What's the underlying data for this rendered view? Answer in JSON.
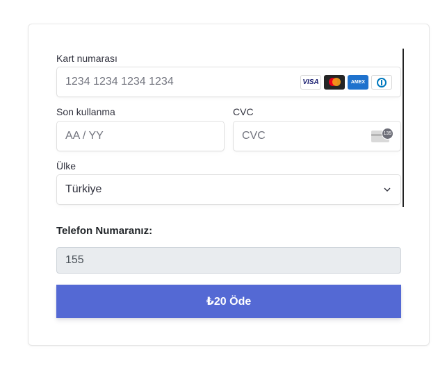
{
  "payment_form": {
    "card_number": {
      "label": "Kart numarası",
      "placeholder": "1234 1234 1234 1234"
    },
    "card_brands": [
      {
        "name": "visa-icon",
        "text": "VISA"
      },
      {
        "name": "mastercard-icon",
        "text": ""
      },
      {
        "name": "amex-icon",
        "text": "AMEX"
      },
      {
        "name": "diners-icon",
        "text": ""
      }
    ],
    "expiry": {
      "label": "Son kullanma",
      "placeholder": "AA / YY"
    },
    "cvc": {
      "label": "CVC",
      "placeholder": "CVC",
      "icon_badge": "135"
    },
    "country": {
      "label": "Ülke",
      "value": "Türkiye"
    }
  },
  "phone": {
    "label": "Telefon Numaranız:",
    "value": "155"
  },
  "submit": {
    "label": "₺20 Öde"
  },
  "colors": {
    "accent": "#5469d4",
    "border": "#e0e0e0",
    "disabled_bg": "#e9ecef"
  }
}
